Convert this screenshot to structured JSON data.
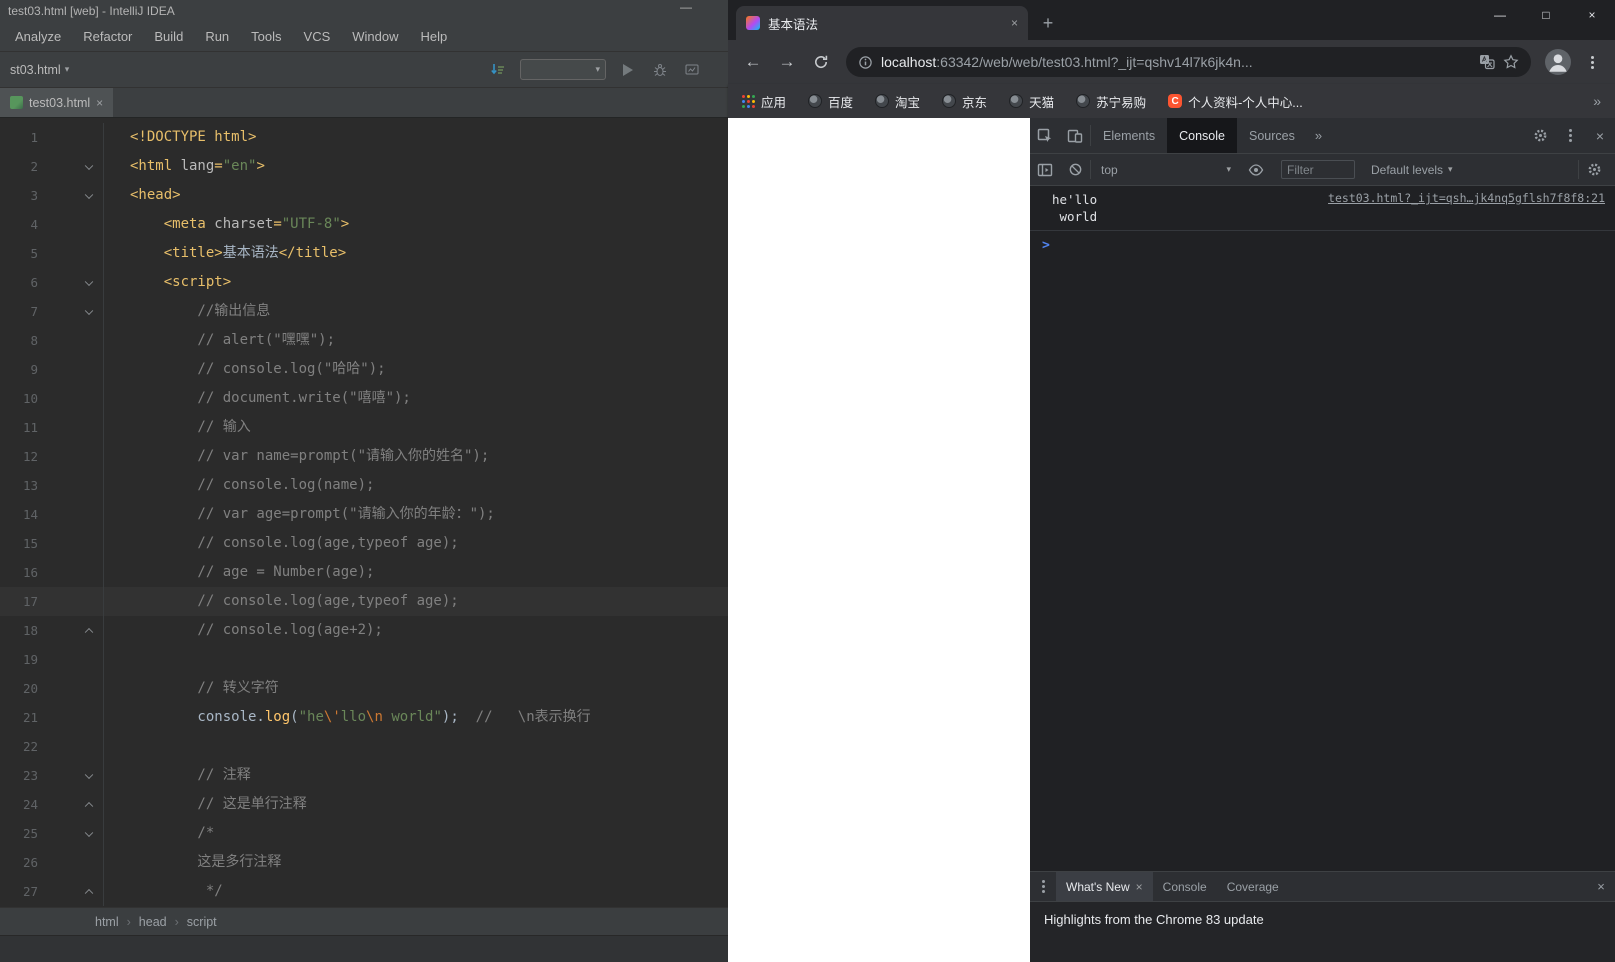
{
  "icons": {
    "minimize": "—",
    "maximize": "□",
    "close": "×",
    "new_tab": "+",
    "back": "←",
    "forward": "→",
    "overflow": "»",
    "dropdown": "▾",
    "breadcrumb_sep": "›",
    "prompt": ">"
  },
  "ide": {
    "window_title": "test03.html [web] - IntelliJ IDEA",
    "menu": [
      "Analyze",
      "Refactor",
      "Build",
      "Run",
      "Tools",
      "VCS",
      "Window",
      "Help"
    ],
    "run_bar": {
      "file_crumb": "st03.html"
    },
    "editor_tab": {
      "label": "test03.html"
    },
    "status_breadcrumbs": [
      "html",
      "head",
      "script"
    ],
    "editor": {
      "current_line": 17,
      "lines": [
        {
          "n": 1,
          "seg": [
            [
              "<!DOCTYPE html>",
              "tag"
            ]
          ]
        },
        {
          "n": 2,
          "fold": "open",
          "seg": [
            [
              "<html ",
              "tag"
            ],
            [
              "lang",
              "attr"
            ],
            [
              "=",
              "tag"
            ],
            [
              "\"en\"",
              "str"
            ],
            [
              ">",
              "tag"
            ]
          ]
        },
        {
          "n": 3,
          "fold": "open",
          "seg": [
            [
              "<head>",
              "tag"
            ]
          ]
        },
        {
          "n": 4,
          "seg": [
            [
              "    <meta ",
              "tag"
            ],
            [
              "charset",
              "attr"
            ],
            [
              "=",
              "tag"
            ],
            [
              "\"UTF-8\"",
              "str"
            ],
            [
              ">",
              "tag"
            ]
          ]
        },
        {
          "n": 5,
          "seg": [
            [
              "    <title>",
              "tag"
            ],
            [
              "基本语法",
              "plain"
            ],
            [
              "</title>",
              "tag"
            ]
          ]
        },
        {
          "n": 6,
          "fold": "open",
          "seg": [
            [
              "    <script>",
              "tag"
            ]
          ]
        },
        {
          "n": 7,
          "fold": "open",
          "seg": [
            [
              "        //输出信息",
              "cmt"
            ]
          ]
        },
        {
          "n": 8,
          "seg": [
            [
              "        // alert(\"嘿嘿\");",
              "cmt"
            ]
          ]
        },
        {
          "n": 9,
          "seg": [
            [
              "        // console.log(\"哈哈\");",
              "cmt"
            ]
          ]
        },
        {
          "n": 10,
          "seg": [
            [
              "        // document.write(\"嘻嘻\");",
              "cmt"
            ]
          ]
        },
        {
          "n": 11,
          "seg": [
            [
              "        // 输入",
              "cmt"
            ]
          ]
        },
        {
          "n": 12,
          "seg": [
            [
              "        // var name=prompt(\"请输入你的姓名\");",
              "cmt"
            ]
          ]
        },
        {
          "n": 13,
          "seg": [
            [
              "        // console.log(name);",
              "cmt"
            ]
          ]
        },
        {
          "n": 14,
          "seg": [
            [
              "        // var age=prompt(\"请输入你的年龄：\");",
              "cmt"
            ]
          ]
        },
        {
          "n": 15,
          "seg": [
            [
              "        // console.log(age,typeof age);",
              "cmt"
            ]
          ]
        },
        {
          "n": 16,
          "seg": [
            [
              "        // age = Number(age);",
              "cmt"
            ]
          ]
        },
        {
          "n": 17,
          "seg": [
            [
              "        // console.log(age,typeof age);",
              "cmt"
            ]
          ]
        },
        {
          "n": 18,
          "fold": "close",
          "seg": [
            [
              "        // console.log(age+2);",
              "cmt"
            ]
          ]
        },
        {
          "n": 19,
          "seg": []
        },
        {
          "n": 20,
          "seg": [
            [
              "        // 转义字符",
              "cmt"
            ]
          ]
        },
        {
          "n": 21,
          "seg": [
            [
              "        console.",
              "plain"
            ],
            [
              "log",
              "fn"
            ],
            [
              "(",
              "plain"
            ],
            [
              "\"he",
              "str"
            ],
            [
              "\\'",
              "esc"
            ],
            [
              "llo",
              "str"
            ],
            [
              "\\n",
              "esc"
            ],
            [
              " world\"",
              "str"
            ],
            [
              ");",
              "plain"
            ],
            [
              "  //   \\n表示换行",
              "cmt"
            ]
          ]
        },
        {
          "n": 22,
          "seg": []
        },
        {
          "n": 23,
          "fold": "open",
          "seg": [
            [
              "        // 注释",
              "cmt"
            ]
          ]
        },
        {
          "n": 24,
          "fold": "close",
          "seg": [
            [
              "        // 这是单行注释",
              "cmt"
            ]
          ]
        },
        {
          "n": 25,
          "fold": "open",
          "seg": [
            [
              "        /*",
              "cmt"
            ]
          ]
        },
        {
          "n": 26,
          "seg": [
            [
              "        这是多行注释",
              "cmt"
            ]
          ]
        },
        {
          "n": 27,
          "fold": "close",
          "seg": [
            [
              "         */",
              "cmt"
            ]
          ]
        }
      ]
    }
  },
  "browser": {
    "tab": {
      "title": "基本语法"
    },
    "address": {
      "host": "localhost",
      "rest": ":63342/web/web/test03.html?_ijt=qshv14l7k6jk4n..."
    },
    "bookmarks": [
      {
        "label": "应用",
        "icon": "apps"
      },
      {
        "label": "百度",
        "icon": "globe"
      },
      {
        "label": "淘宝",
        "icon": "globe"
      },
      {
        "label": "京东",
        "icon": "globe"
      },
      {
        "label": "天猫",
        "icon": "globe"
      },
      {
        "label": "苏宁易购",
        "icon": "globe"
      },
      {
        "label": "个人资料-个人中心...",
        "icon": "csdn"
      }
    ],
    "devtools": {
      "tabs": [
        {
          "label": "Elements",
          "active": false
        },
        {
          "label": "Console",
          "active": true
        },
        {
          "label": "Sources",
          "active": false
        }
      ],
      "console_toolbar": {
        "context": "top",
        "filter_placeholder": "Filter",
        "levels": "Default levels"
      },
      "console": {
        "lines": [
          "he'llo",
          " world"
        ],
        "source_link": "test03.html?_ijt=qsh…jk4nq5gflsh7f8f8:21"
      },
      "drawer": {
        "tabs": [
          {
            "label": "What's New",
            "active": true,
            "closable": true
          },
          {
            "label": "Console",
            "active": false
          },
          {
            "label": "Coverage",
            "active": false
          }
        ],
        "content_title": "Highlights from the Chrome 83 update"
      }
    }
  }
}
